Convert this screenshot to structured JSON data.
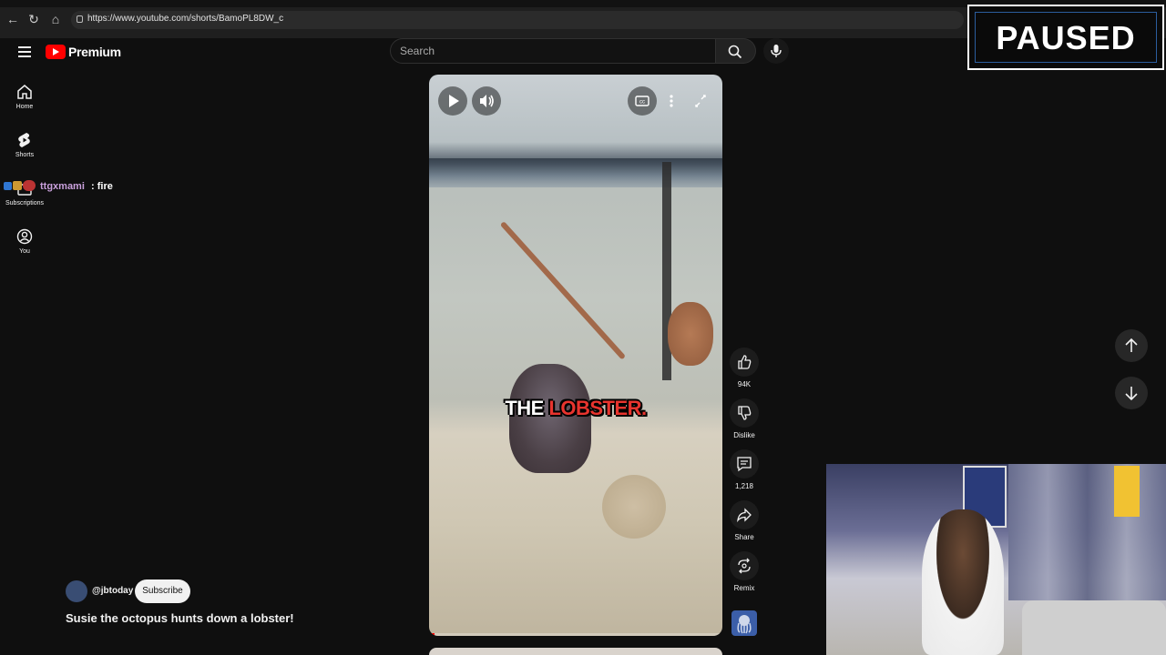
{
  "browser": {
    "url": "https://www.youtube.com/shorts/BamoPL8DW_c"
  },
  "header": {
    "logo_text": "Premium",
    "search_placeholder": "Search"
  },
  "sidebar": {
    "items": [
      {
        "label": "Home",
        "icon": "home-icon"
      },
      {
        "label": "Shorts",
        "icon": "shorts-icon"
      },
      {
        "label": "Subscriptions",
        "icon": "subscriptions-icon"
      },
      {
        "label": "You",
        "icon": "you-icon"
      }
    ]
  },
  "chat_overlay": {
    "username": "ttgxmami",
    "message": ": fire"
  },
  "short": {
    "caption_word1": "THE",
    "caption_word2": "LOBSTER.",
    "channel_handle": "@jbtoday",
    "subscribe_label": "Subscribe",
    "title": "Susie the octopus hunts down a lobster!",
    "progress": 0.02
  },
  "actions": {
    "like_count": "94K",
    "dislike_label": "Dislike",
    "comment_count": "1,218",
    "share_label": "Share",
    "remix_label": "Remix"
  },
  "stream_overlay": {
    "paused_text": "PAUSED"
  },
  "colors": {
    "brand_red": "#ff0000",
    "caption_red": "#e8342e",
    "chat_name": "#c9a0dc"
  }
}
